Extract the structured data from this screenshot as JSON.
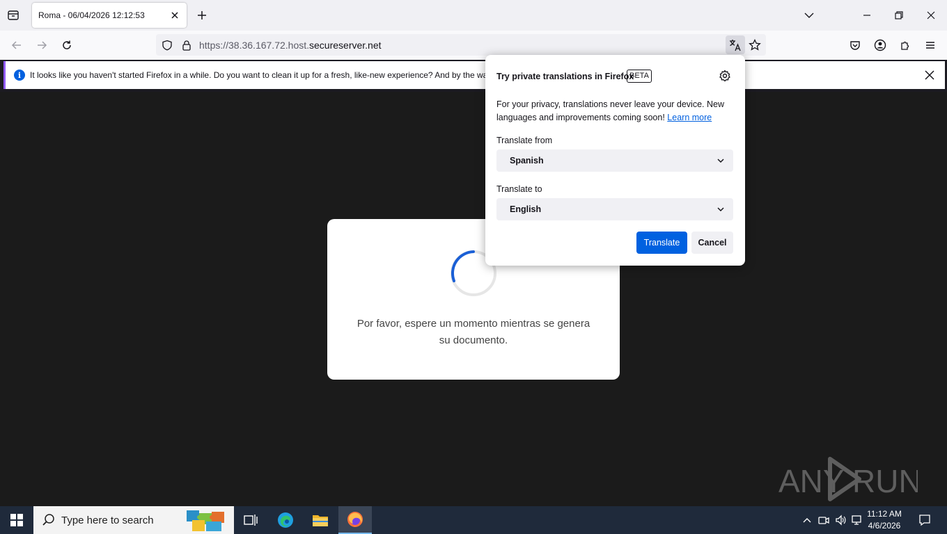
{
  "tab": {
    "title": "Roma - 06/04/2026 12:12:53"
  },
  "url": {
    "prefix": "https://38.36.167.72.host.",
    "domain": "secureserver.net"
  },
  "notification": {
    "text": "It looks like you haven't started Firefox in a while. Do you want to clean it up for a fresh, like-new experience? And by the wa"
  },
  "page": {
    "loading_text": "Por favor, espere un momento mientras se genera su documento."
  },
  "translation_popup": {
    "title": "Try private translations in Firefox",
    "beta": "BETA",
    "description": "For your privacy, translations never leave your device. New languages and improvements coming soon!",
    "learn_more": "Learn more",
    "from_label": "Translate from",
    "from_value": "Spanish",
    "to_label": "Translate to",
    "to_value": "English",
    "translate_button": "Translate",
    "cancel_button": "Cancel"
  },
  "watermark": {
    "left": "ANY",
    "right": "RUN"
  },
  "taskbar": {
    "search_placeholder": "Type here to search",
    "time": "11:12 AM",
    "date": "4/6/2026"
  },
  "colors": {
    "accent": "#0061e0",
    "notification_stripe": "#9059ff",
    "taskbar": "#1f2a3b"
  }
}
